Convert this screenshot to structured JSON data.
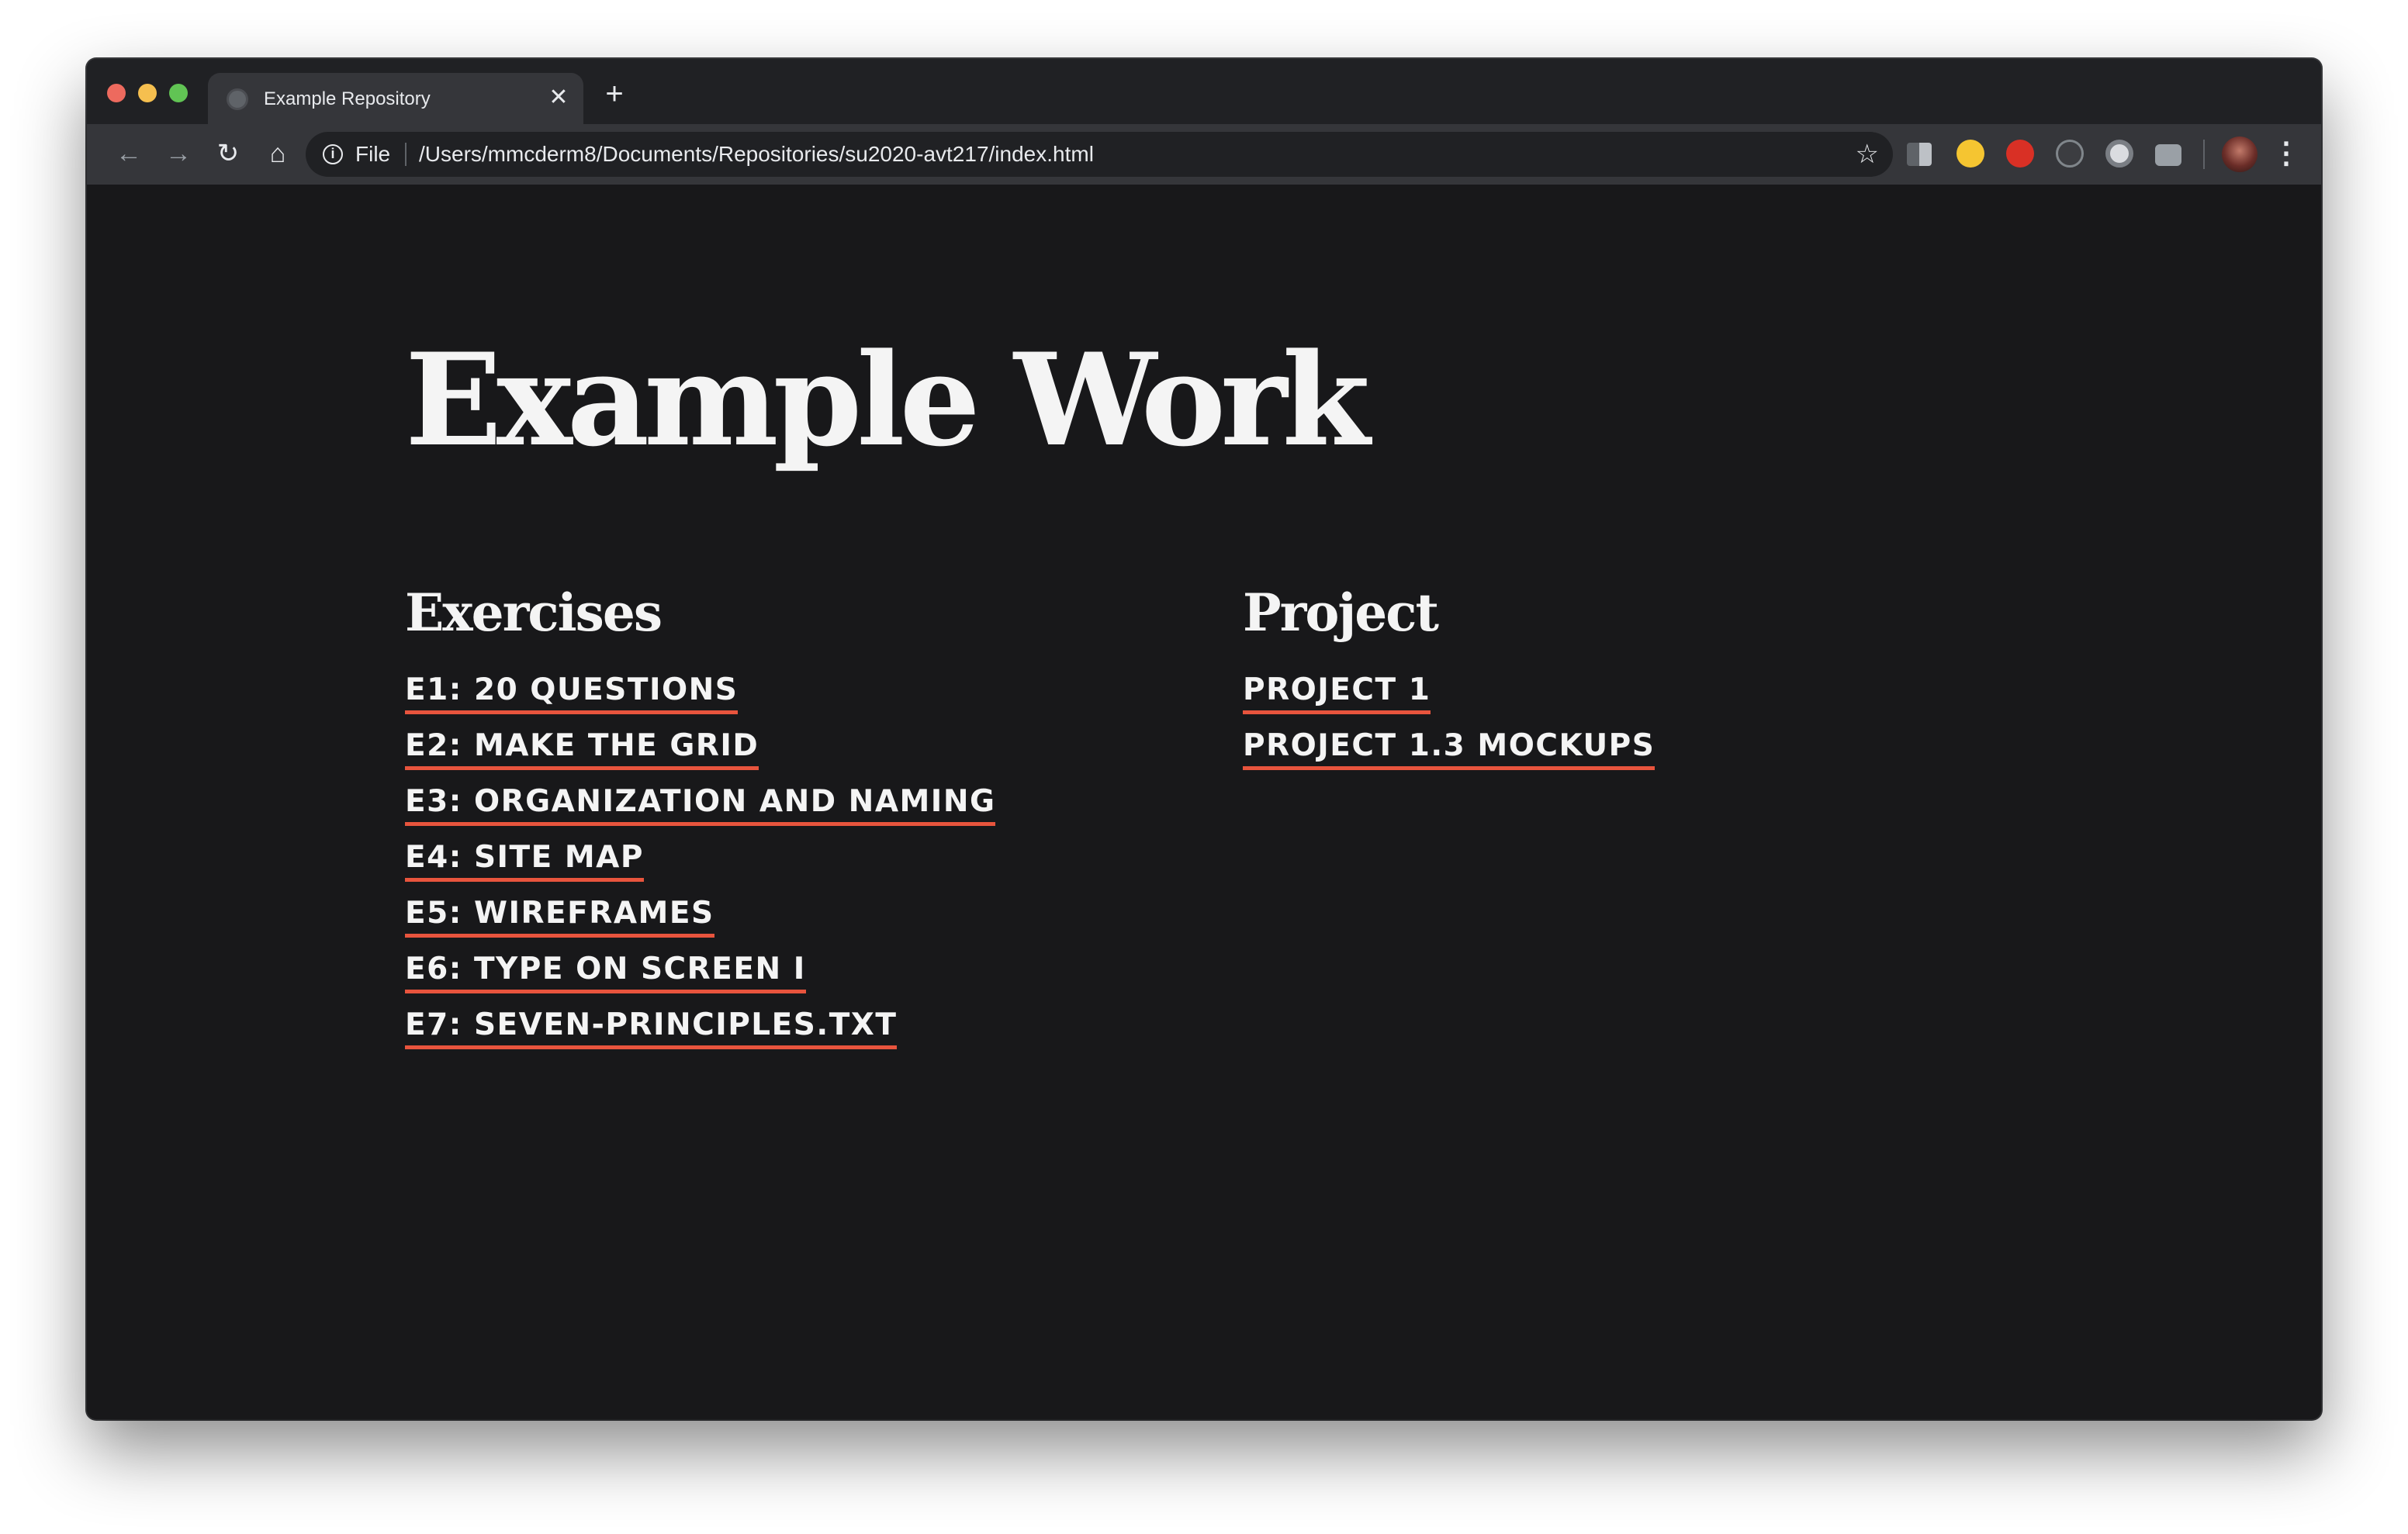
{
  "browser": {
    "tab": {
      "title": "Example Repository",
      "close_glyph": "✕"
    },
    "new_tab_glyph": "+",
    "toolbar": {
      "back_glyph": "←",
      "forward_glyph": "→",
      "reload_glyph": "↻",
      "home_glyph": "⌂",
      "info_glyph": "i",
      "scheme_label": "File",
      "url": "/Users/mmcderm8/Documents/Repositories/su2020-avt217/index.html",
      "bookmark_glyph": "☆",
      "menu_glyph": "⋮"
    },
    "extensions": [
      "extension-icon",
      "emoji-extension-icon",
      "stop-extension-icon",
      "circle-extension-icon",
      "record-extension-icon",
      "camera-extension-icon"
    ]
  },
  "page": {
    "title": "Example Work",
    "exercises": {
      "heading": "Exercises",
      "links": [
        "E1: 20 QUESTIONS",
        "E2: MAKE THE GRID",
        "E3: ORGANIZATION AND NAMING",
        "E4: SITE MAP",
        "E5: WIREFRAMES",
        "E6: TYPE ON SCREEN I",
        "E7: SEVEN-PRINCIPLES.TXT"
      ]
    },
    "project": {
      "heading": "Project",
      "links": [
        "PROJECT 1",
        "PROJECT 1.3 MOCKUPS"
      ]
    }
  },
  "colors": {
    "page_background": "#18181a",
    "text": "#f4f4f4",
    "link_underline": "#e8543d"
  }
}
